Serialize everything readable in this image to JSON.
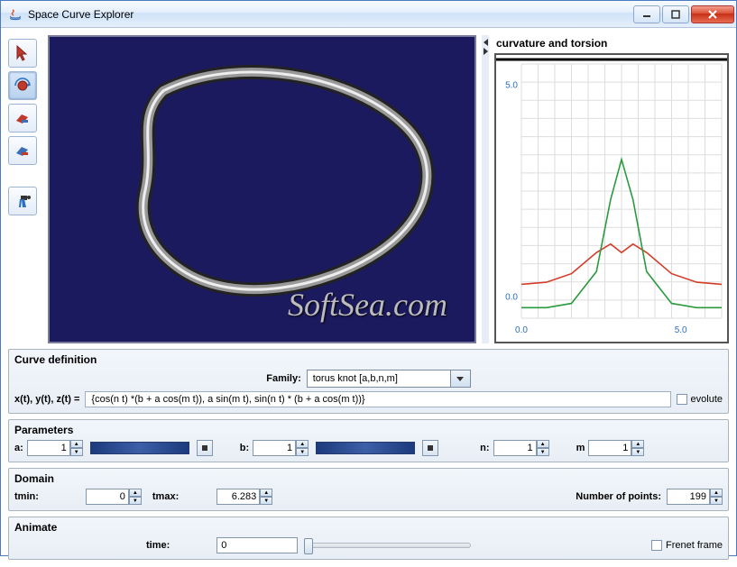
{
  "window": {
    "title": "Space Curve Explorer"
  },
  "watermark": "SoftSea.com",
  "chart": {
    "title": "curvature and torsion"
  },
  "chart_data": {
    "type": "line",
    "xlabel": "",
    "ylabel": "",
    "xlim": [
      0,
      6.283
    ],
    "ylim": [
      -0.5,
      5.5
    ],
    "xticks": [
      {
        "pos": 0,
        "label": "0.0"
      },
      {
        "pos": 5,
        "label": "5.0"
      }
    ],
    "yticks": [
      {
        "pos": 0,
        "label": "0.0"
      },
      {
        "pos": 5,
        "label": "5.0"
      }
    ],
    "series": [
      {
        "name": "curvature",
        "color": "#d43d2a",
        "x": [
          0,
          0.785,
          1.571,
          2.356,
          2.8,
          3.142,
          3.5,
          3.927,
          4.712,
          5.498,
          6.283
        ],
        "y": [
          0.3,
          0.35,
          0.55,
          1.05,
          1.25,
          1.05,
          1.25,
          1.05,
          0.55,
          0.35,
          0.3
        ]
      },
      {
        "name": "torsion",
        "color": "#2a9a3d",
        "x": [
          0,
          0.785,
          1.571,
          2.356,
          2.8,
          3.142,
          3.5,
          3.927,
          4.712,
          5.498,
          6.283
        ],
        "y": [
          -0.25,
          -0.25,
          -0.15,
          0.6,
          2.3,
          3.25,
          2.3,
          0.6,
          -0.15,
          -0.25,
          -0.25
        ]
      }
    ]
  },
  "definition": {
    "section_label": "Curve definition",
    "family_label": "Family:",
    "family_value": "torus knot [a,b,n,m]",
    "formula_label": "x(t), y(t), z(t) =",
    "formula_value": "{cos(n t) *(b + a cos(m t)), a sin(m t), sin(n t) * (b + a cos(m t))}",
    "evolute_label": "evolute",
    "evolute_checked": false
  },
  "parameters": {
    "section_label": "Parameters",
    "a": {
      "label": "a:",
      "value": "1"
    },
    "b": {
      "label": "b:",
      "value": "1"
    },
    "n": {
      "label": "n:",
      "value": "1"
    },
    "m": {
      "label": "m",
      "value": "1"
    }
  },
  "domain": {
    "section_label": "Domain",
    "tmin_label": "tmin:",
    "tmin_value": "0",
    "tmax_label": "tmax:",
    "tmax_value": "6.283",
    "npoints_label": "Number of points:",
    "npoints_value": "199"
  },
  "animate": {
    "section_label": "Animate",
    "time_label": "time:",
    "time_value": "0",
    "frenet_label": "Frenet frame",
    "frenet_checked": false
  },
  "tools": {
    "select": "select-tool",
    "rotate": "rotate-tool",
    "color1": "color-red-tool",
    "color2": "color-blue-tool",
    "camera": "camera-tool"
  }
}
